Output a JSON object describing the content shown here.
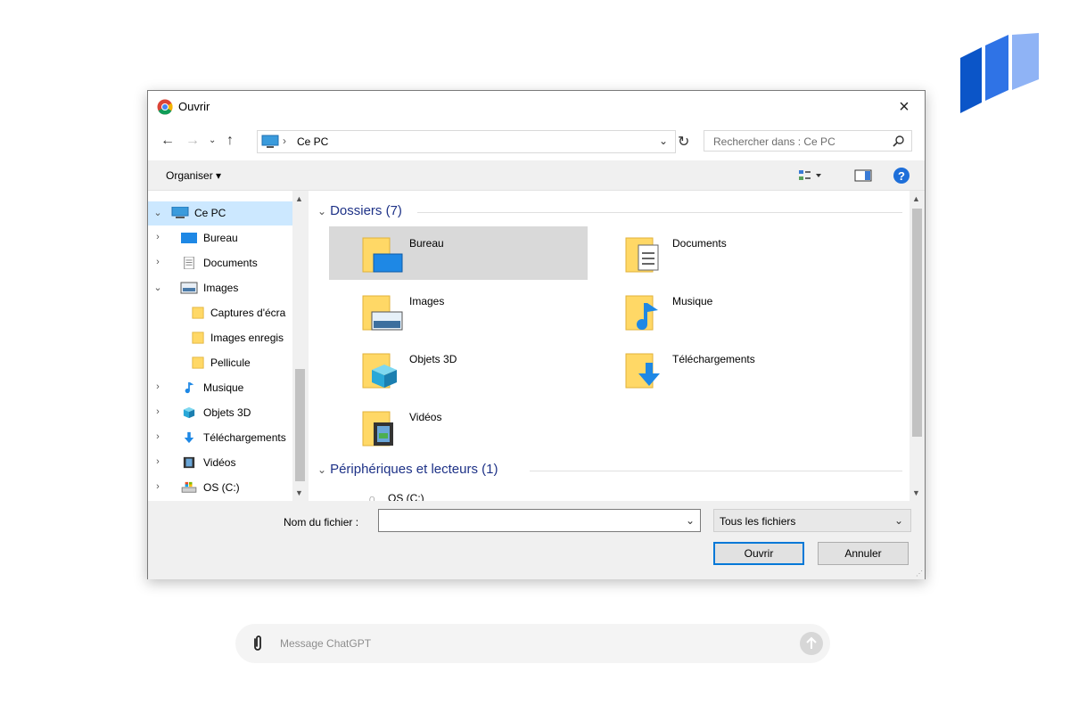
{
  "dialog": {
    "title": "Ouvrir",
    "close_label": "×"
  },
  "address": {
    "location": "Ce PC",
    "separator": "›",
    "search_placeholder": "Rechercher dans : Ce PC"
  },
  "toolbar": {
    "organize_label": "Organiser ▾"
  },
  "nav": {
    "items": [
      {
        "label": "Ce PC",
        "chevron": "⌄",
        "icon": "pc-icon",
        "selected": true
      },
      {
        "label": "Bureau",
        "chevron": "›",
        "icon": "desktop-icon"
      },
      {
        "label": "Documents",
        "chevron": "›",
        "icon": "documents-icon"
      },
      {
        "label": "Images",
        "chevron": "⌄",
        "icon": "images-icon"
      },
      {
        "label": "Captures d'écra",
        "chevron": "",
        "icon": "folder-icon"
      },
      {
        "label": "Images enregis",
        "chevron": "",
        "icon": "folder-icon"
      },
      {
        "label": "Pellicule",
        "chevron": "",
        "icon": "folder-icon"
      },
      {
        "label": "Musique",
        "chevron": "›",
        "icon": "music-icon"
      },
      {
        "label": "Objets 3D",
        "chevron": "›",
        "icon": "objects3d-icon"
      },
      {
        "label": "Téléchargements",
        "chevron": "›",
        "icon": "download-icon"
      },
      {
        "label": "Vidéos",
        "chevron": "›",
        "icon": "video-icon"
      },
      {
        "label": "OS (C:)",
        "chevron": "›",
        "icon": "drive-icon"
      }
    ]
  },
  "content": {
    "folders_header": "Dossiers (7)",
    "folders": [
      {
        "label": "Bureau",
        "icon": "desktop-folder-icon",
        "selected": true
      },
      {
        "label": "Documents",
        "icon": "documents-folder-icon"
      },
      {
        "label": "Images",
        "icon": "images-folder-icon"
      },
      {
        "label": "Musique",
        "icon": "music-folder-icon"
      },
      {
        "label": "Objets 3D",
        "icon": "objects3d-folder-icon"
      },
      {
        "label": "Téléchargements",
        "icon": "download-folder-icon"
      },
      {
        "label": "Vidéos",
        "icon": "video-folder-icon"
      }
    ],
    "devices_header": "Périphériques et lecteurs (1)",
    "device_label": "OS (C:)"
  },
  "bottom": {
    "filename_label": "Nom du fichier :",
    "filename_value": "",
    "filter_value": "Tous les fichiers",
    "open_label": "Ouvrir",
    "cancel_label": "Annuler"
  },
  "chat": {
    "placeholder": "Message ChatGPT"
  },
  "colors": {
    "accent": "#0078d7",
    "selection": "#cce8ff",
    "folder_yellow": "#ffd866",
    "group_header": "#1e3287"
  }
}
